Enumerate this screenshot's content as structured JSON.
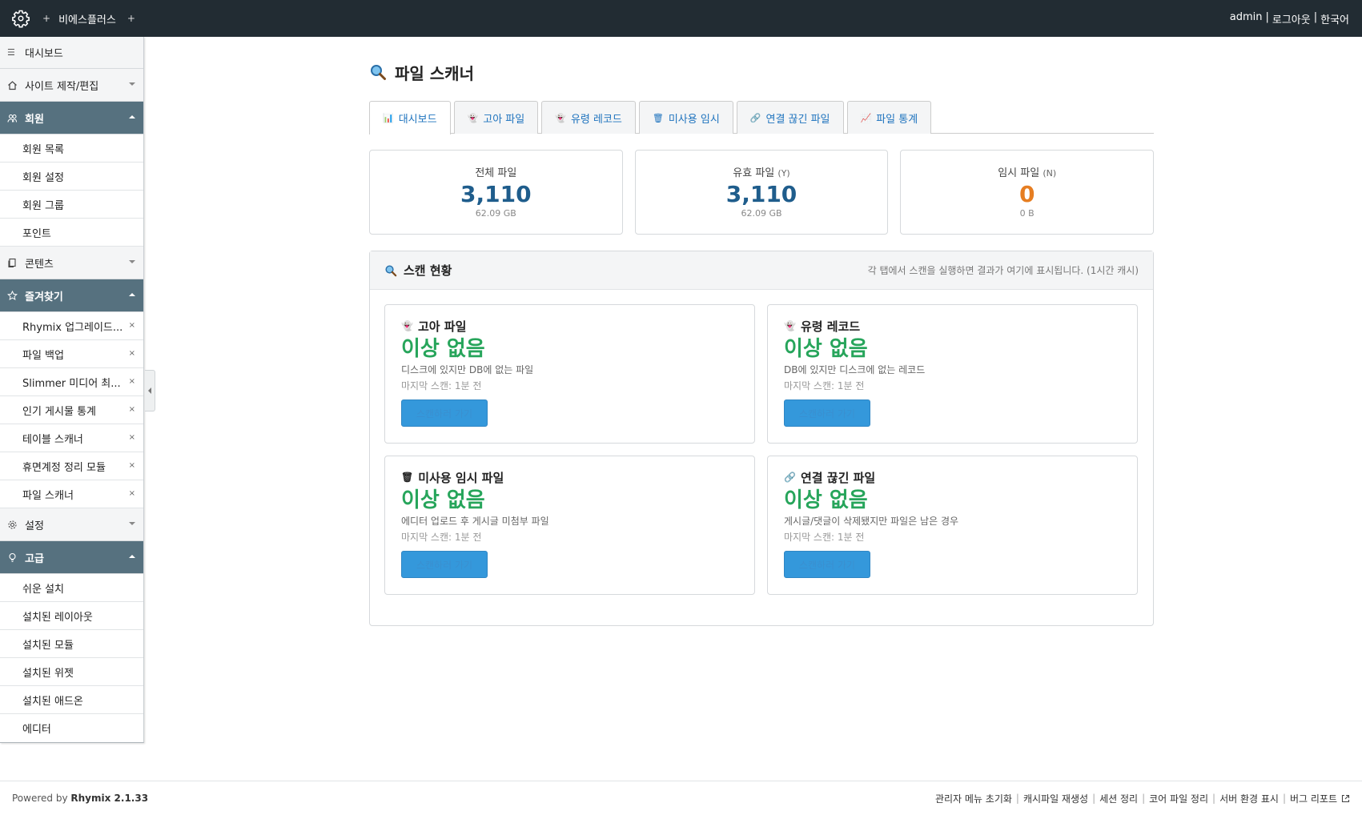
{
  "header": {
    "plus_left": "+",
    "site_name": "비에스플러스",
    "plus_right": "+",
    "user": "admin",
    "logout": "로그아웃",
    "language": "한국어",
    "separator": "|"
  },
  "sidebar": {
    "dashboard": "대시보드",
    "groups": {
      "site": "사이트 제작/편집",
      "member": "회원",
      "contents": "콘텐츠",
      "favorites": "즐겨찾기",
      "settings": "설정",
      "advanced": "고급"
    },
    "member_items": [
      "회원 목록",
      "회원 설정",
      "회원 그룹",
      "포인트"
    ],
    "favorite_items": [
      "Rhymix 업그레이드...",
      "파일 백업",
      "Slimmer 미디어 최...",
      "인기 게시물 통계",
      "테이블 스캐너",
      "휴면계정 정리 모듈",
      "파일 스캐너"
    ],
    "advanced_items": [
      "쉬운 설치",
      "설치된 레이아웃",
      "설치된 모듈",
      "설치된 위젯",
      "설치된 애드온",
      "에디터"
    ],
    "remove_glyph": "×"
  },
  "main": {
    "title": "파일 스캐너",
    "tabs": [
      {
        "icon": "📊",
        "label": "대시보드"
      },
      {
        "icon": "👻",
        "label": "고아 파일"
      },
      {
        "icon": "👻",
        "label": "유령 레코드"
      },
      {
        "icon": "🗑",
        "label": "미사용 임시"
      },
      {
        "icon": "🔗",
        "label": "연결 끊긴 파일"
      },
      {
        "icon": "📈",
        "label": "파일 통계"
      }
    ],
    "stats": [
      {
        "label": "전체 파일",
        "sub": "",
        "value": "3,110",
        "size": "62.09 GB"
      },
      {
        "label": "유효 파일",
        "sub": "(Y)",
        "value": "3,110",
        "size": "62.09 GB"
      },
      {
        "label": "임시 파일",
        "sub": "(N)",
        "value": "0",
        "size": "0 B"
      }
    ],
    "panel": {
      "title": "스캔 현황",
      "note": "각 탭에서 스캔을 실행하면 결과가 여기에 표시됩니다. (1시간 캐시)",
      "cards": [
        {
          "icon": "👻",
          "title": "고아 파일",
          "status": "이상 없음",
          "desc": "디스크에 있지만 DB에 없는 파일",
          "last": "마지막 스캔: 1분 전",
          "button": "스캔하러 가기"
        },
        {
          "icon": "👻",
          "title": "유령 레코드",
          "status": "이상 없음",
          "desc": "DB에 있지만 디스크에 없는 레코드",
          "last": "마지막 스캔: 1분 전",
          "button": "스캔하러 가기"
        },
        {
          "icon": "🗑",
          "title": "미사용 임시 파일",
          "status": "이상 없음",
          "desc": "에디터 업로드 후 게시글 미첨부 파일",
          "last": "마지막 스캔: 1분 전",
          "button": "스캔하러 가기"
        },
        {
          "icon": "🔗",
          "title": "연결 끊긴 파일",
          "status": "이상 없음",
          "desc": "게시글/댓글이 삭제됐지만 파일은 남은 경우",
          "last": "마지막 스캔: 1분 전",
          "button": "스캔하러 가기"
        }
      ]
    }
  },
  "footer": {
    "powered": "Powered by",
    "brand": "Rhymix 2.1.33",
    "links": [
      "관리자 메뉴 초기화",
      "캐시파일 재생성",
      "세션 정리",
      "코어 파일 정리",
      "서버 환경 표시",
      "버그 리포트"
    ],
    "separator": "|"
  },
  "colors": {
    "header_bg": "#222c33",
    "sidebar_open_bg": "#56717f",
    "link": "#1e73be",
    "stat_number": "#1f5d8c",
    "stat_zero": "#e67e22",
    "status_ok": "#27a55b",
    "button": "#3498db"
  }
}
